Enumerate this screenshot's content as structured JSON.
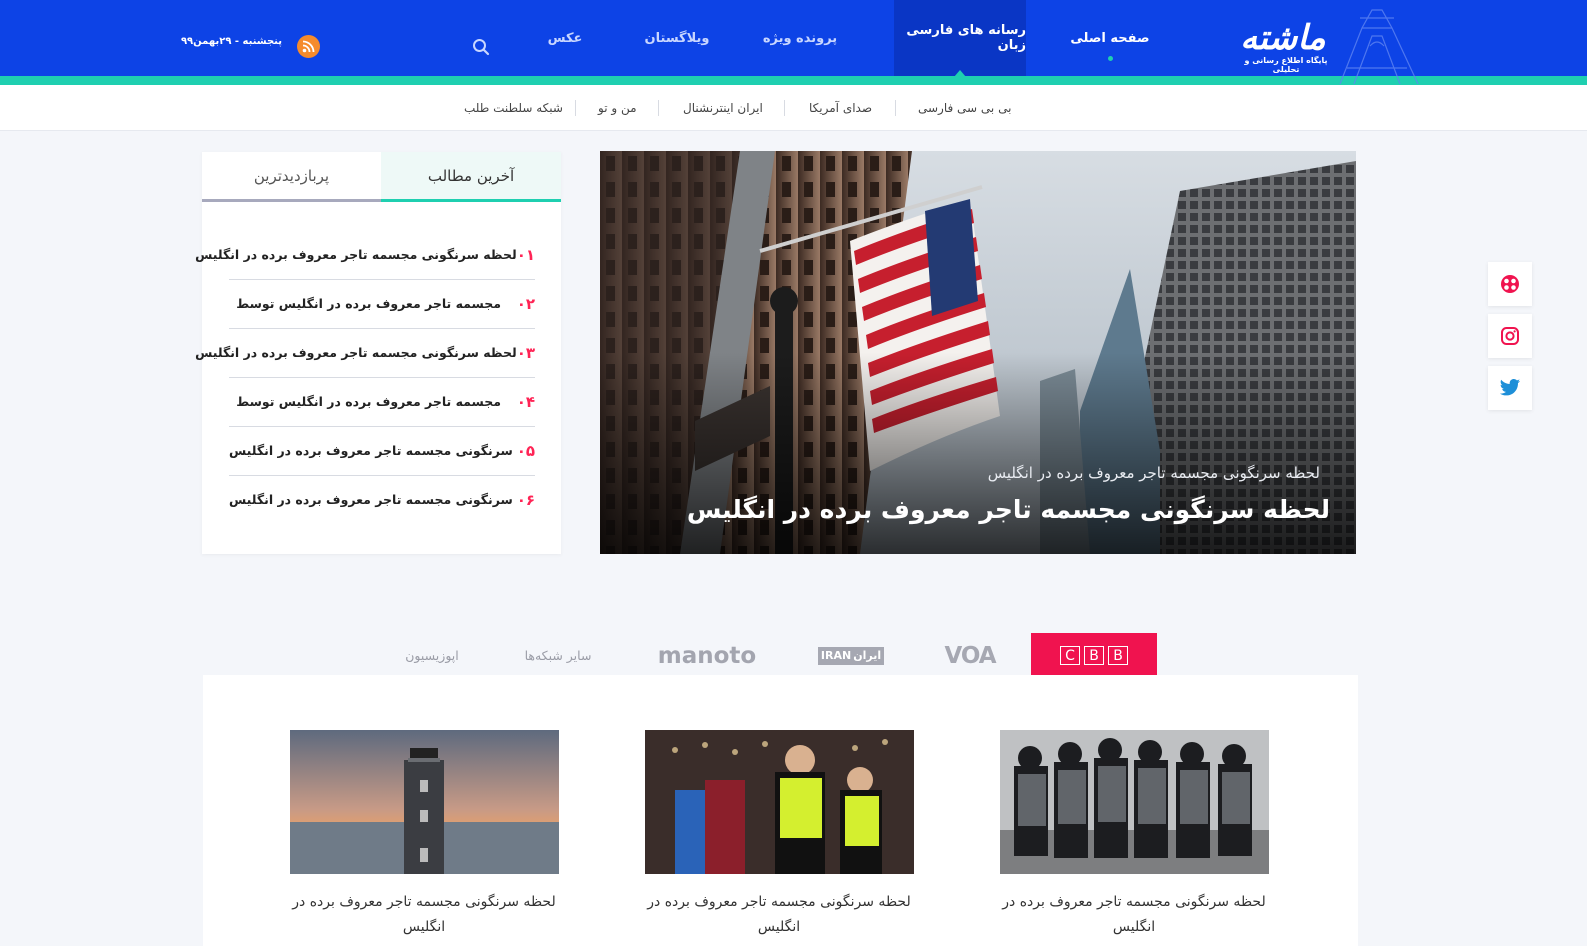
{
  "header": {
    "logo_text": "ماشته",
    "logo_tagline": "پایگاه اطلاع رسانی و تحلیلی",
    "nav": [
      {
        "label": "صفحه اصلی"
      },
      {
        "label": "رسانه های فارسی زبان"
      },
      {
        "label": "پرونده ویژه"
      },
      {
        "label": "ویلاگستان"
      },
      {
        "label": "عکس"
      }
    ],
    "date": "پنجشنبه - ۲۹بهمن۹۹",
    "search_icon": "search-icon",
    "rss_icon": "rss-icon"
  },
  "subnav": [
    {
      "label": "بی بی سی فارسی"
    },
    {
      "label": "صدای آمریکا"
    },
    {
      "label": "ایران اینترنشنال"
    },
    {
      "label": "من و تو"
    },
    {
      "label": "شبکه سلطنت طلب"
    }
  ],
  "hero": {
    "kicker": "لحظه سرنگونی مجسمه تاجر معروف برده در انگلیس",
    "title": "لحظه سرنگونی مجسمه تاجر معروف برده در انگلیس"
  },
  "side_panel": {
    "tabs": [
      {
        "label": "آخرین مطالب"
      },
      {
        "label": "پربازدیدترین"
      }
    ],
    "items": [
      {
        "num": "۰۱",
        "text": "لحظه سرنگونی مجسمه تاجر معروف برده در انگلیس"
      },
      {
        "num": "۰۲",
        "text": "مجسمه تاجر معروف برده در انگلیس توسط"
      },
      {
        "num": "۰۳",
        "text": "لحظه سرنگونی مجسمه تاجر معروف برده در انگلیس"
      },
      {
        "num": "۰۴",
        "text": "مجسمه تاجر معروف برده در انگلیس توسط"
      },
      {
        "num": "۰۵",
        "text": "سرنگونی مجسمه تاجر معروف برده در انگلیس"
      },
      {
        "num": "۰۶",
        "text": "سرنگونی مجسمه تاجر معروف برده در انگلیس"
      }
    ]
  },
  "social": [
    "aparat-icon",
    "instagram-icon",
    "twitter-icon"
  ],
  "channels": {
    "bbc_letters": [
      "B",
      "B",
      "C"
    ],
    "voa": "VOA",
    "iran_international": "IRAN",
    "iran_international_fa": "ایران",
    "manoto": "manoto",
    "others": "سایر شبکه‌ها",
    "opposition": "اپوزیسیون"
  },
  "cards": [
    {
      "title": "لحظه سرنگونی مجسمه تاجر معروف برده در انگلیس"
    },
    {
      "title": "لحظه سرنگونی مجسمه تاجر معروف برده در انگلیس"
    },
    {
      "title": "لحظه سرنگونی مجسمه تاجر معروف برده در انگلیس"
    }
  ],
  "colors": {
    "brand_blue": "#0d43e6",
    "accent_teal": "#1fcfb0",
    "accent_red": "#f0134f",
    "number_red": "#ff2455"
  }
}
